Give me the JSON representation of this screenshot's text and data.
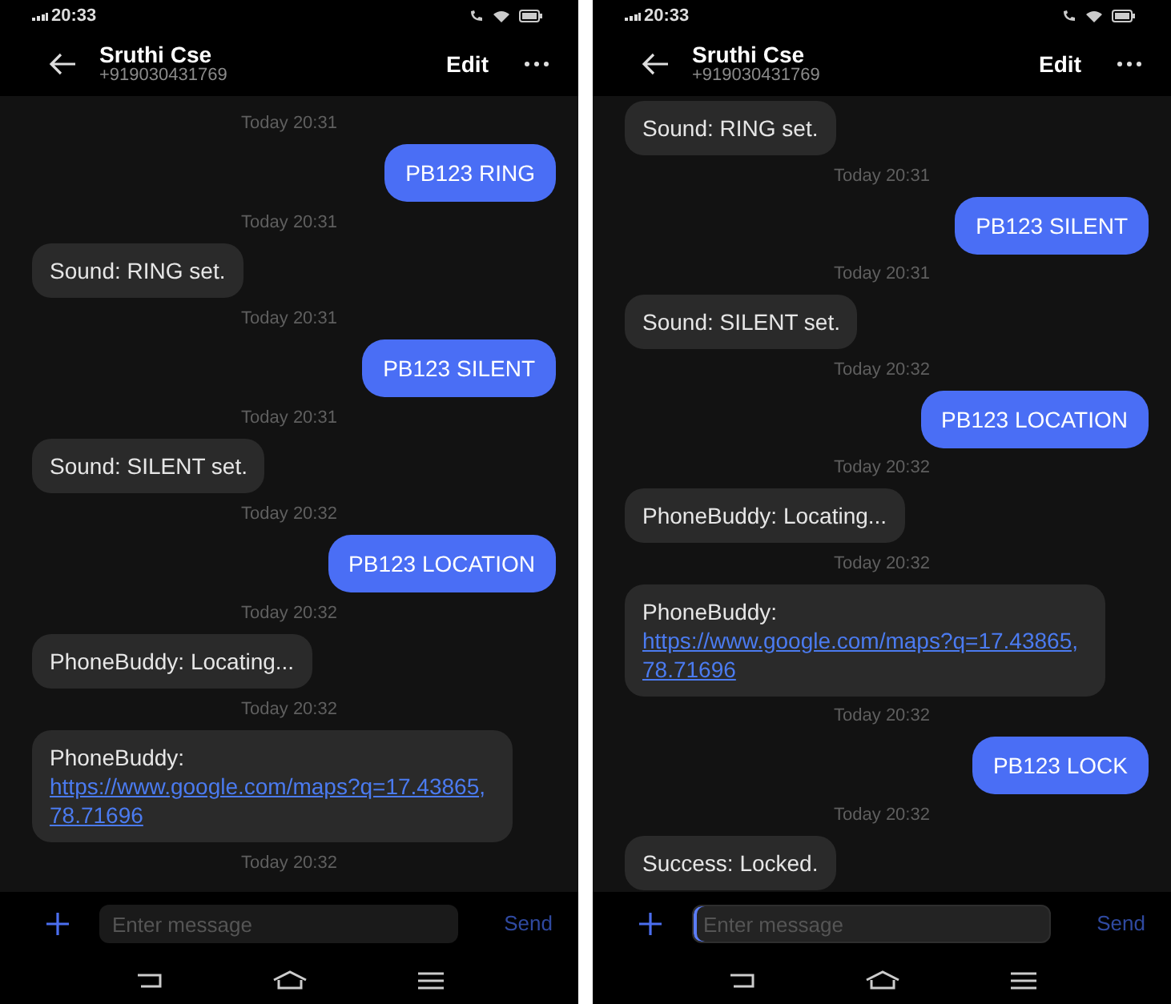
{
  "phones": [
    {
      "status_time": "20:33",
      "contact": {
        "name": "Sruthi Cse",
        "number": "+919030431769"
      },
      "edit": "Edit",
      "messages": [
        {
          "kind": "time",
          "text": "Today 20:31"
        },
        {
          "kind": "sent",
          "text": "PB123 RING"
        },
        {
          "kind": "time",
          "text": "Today 20:31"
        },
        {
          "kind": "received",
          "text": "Sound: RING set."
        },
        {
          "kind": "time",
          "text": "Today 20:31"
        },
        {
          "kind": "sent",
          "text": "PB123 SILENT"
        },
        {
          "kind": "time",
          "text": "Today 20:31"
        },
        {
          "kind": "received",
          "text": "Sound: SILENT set."
        },
        {
          "kind": "time",
          "text": "Today 20:32"
        },
        {
          "kind": "sent",
          "text": "PB123 LOCATION"
        },
        {
          "kind": "time",
          "text": "Today 20:32"
        },
        {
          "kind": "received",
          "text": "PhoneBuddy: Locating..."
        },
        {
          "kind": "time",
          "text": "Today 20:32"
        },
        {
          "kind": "received",
          "text": "PhoneBuddy:",
          "link": "https://www.google.com/maps?q=17.43865,78.71696"
        },
        {
          "kind": "time",
          "text": "Today 20:32"
        }
      ],
      "composer": {
        "placeholder": "Enter message",
        "focused": false,
        "send": "Send"
      }
    },
    {
      "status_time": "20:33",
      "contact": {
        "name": "Sruthi Cse",
        "number": "+919030431769"
      },
      "edit": "Edit",
      "messages": [
        {
          "kind": "received",
          "text": "Sound: RING set."
        },
        {
          "kind": "time",
          "text": "Today 20:31"
        },
        {
          "kind": "sent",
          "text": "PB123 SILENT"
        },
        {
          "kind": "time",
          "text": "Today 20:31"
        },
        {
          "kind": "received",
          "text": "Sound: SILENT set."
        },
        {
          "kind": "time",
          "text": "Today 20:32"
        },
        {
          "kind": "sent",
          "text": "PB123 LOCATION"
        },
        {
          "kind": "time",
          "text": "Today 20:32"
        },
        {
          "kind": "received",
          "text": "PhoneBuddy: Locating..."
        },
        {
          "kind": "time",
          "text": "Today 20:32"
        },
        {
          "kind": "received",
          "text": "PhoneBuddy:",
          "link": "https://www.google.com/maps?q=17.43865,78.71696"
        },
        {
          "kind": "time",
          "text": "Today 20:32"
        },
        {
          "kind": "sent",
          "text": "PB123 LOCK"
        },
        {
          "kind": "time",
          "text": "Today 20:32"
        },
        {
          "kind": "received",
          "text": "Success: Locked."
        }
      ],
      "composer": {
        "placeholder": "Enter message",
        "focused": true,
        "send": "Send"
      }
    }
  ]
}
